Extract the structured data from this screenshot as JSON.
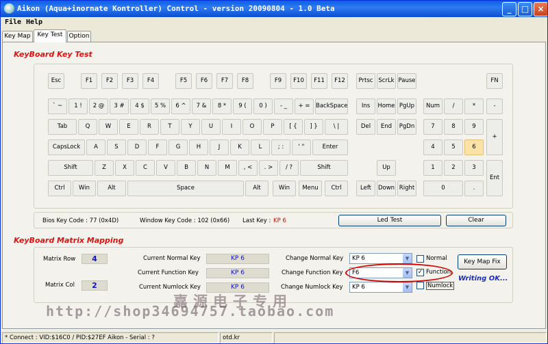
{
  "window": {
    "title": "Aikon (Aqua+inornate Kontroller) Control - version 20090804 - 1.0 Beta",
    "buttons": {
      "minimize": "_",
      "maximize": "□",
      "close": "×"
    }
  },
  "menu": [
    {
      "label": "File"
    },
    {
      "label": "Help"
    }
  ],
  "tabs": [
    {
      "label": "Key Map",
      "active": false
    },
    {
      "label": "Key Test",
      "active": true
    },
    {
      "label": "Option",
      "active": false
    }
  ],
  "keyboard_section": {
    "title": "KeyBoard Key Test",
    "keys": {
      "esc": "Esc",
      "f1": "F1",
      "f2": "F2",
      "f3": "F3",
      "f4": "F4",
      "f5": "F5",
      "f6": "F6",
      "f7": "F7",
      "f8": "F8",
      "f9": "F9",
      "f10": "F10",
      "f11": "F11",
      "f12": "F12",
      "prtsc": "Prtsc",
      "scrlk": "ScrLk",
      "pause": "Pause",
      "fn": "FN",
      "tilde": "` ~",
      "k1": "1 !",
      "k2": "2 @",
      "k3": "3 #",
      "k4": "4 $",
      "k5": "5 %",
      "k6": "6 ^",
      "k7": "7 &",
      "k8": "8 *",
      "k9": "9 (",
      "k0": "0 )",
      "minus": "- _",
      "equal": "+ =",
      "backspace": "BackSpace",
      "ins": "Ins",
      "home": "Home",
      "pgup": "PgUp",
      "num": "Num",
      "slash": "/",
      "star": "*",
      "kpminus": "-",
      "tab": "Tab",
      "q": "Q",
      "w": "W",
      "e": "E",
      "r": "R",
      "t": "T",
      "y": "Y",
      "u": "U",
      "i": "I",
      "o": "O",
      "p": "P",
      "lbracket": "[ {",
      "rbracket": "] }",
      "backslash": "\\ |",
      "del": "Del",
      "end": "End",
      "pgdn": "PgDn",
      "kp7": "7",
      "kp8": "8",
      "kp9": "9",
      "kpplus": "+",
      "capslock": "CapsLock",
      "a": "A",
      "s": "S",
      "d": "D",
      "f": "F",
      "g": "G",
      "h": "H",
      "j": "J",
      "k": "K",
      "l": "L",
      "semicolon": ";  :",
      "quote": "' \"",
      "enter": "Enter",
      "kp4": "4",
      "kp5": "5",
      "kp6": "6",
      "lshift": "Shift",
      "z": "Z",
      "x": "X",
      "c": "C",
      "v": "V",
      "b": "B",
      "n": "N",
      "m": "M",
      "comma": ", <",
      "period": ". >",
      "question": "/ ?",
      "rshift": "Shift",
      "up": "Up",
      "kp1": "1",
      "kp2": "2",
      "kp3": "3",
      "kpenter": "Ent",
      "lctrl": "Ctrl",
      "lwin": "Win",
      "lalt": "Alt",
      "space": "Space",
      "ralt": "Alt",
      "rwin": "Win",
      "menu": "Menu",
      "rctrl": "Ctrl",
      "left": "Left",
      "down": "Down",
      "right": "Right",
      "kp0": "0",
      "kpdot": "."
    },
    "bios_label": "Bios Key Code : 77 (0x4D)",
    "window_label": "Window Key Code : 102 (0x66)",
    "last_label": "Last Key :",
    "last_value": "KP 6",
    "led_test": "Led Test",
    "clear": "Clear"
  },
  "matrix_section": {
    "title": "KeyBoard Matrix Mapping",
    "matrix_row_label": "Matrix Row",
    "matrix_row_value": "4",
    "matrix_col_label": "Matrix Col",
    "matrix_col_value": "2",
    "current_normal_label": "Current Normal Key",
    "current_normal_value": "KP 6",
    "current_function_label": "Current Function Key",
    "current_function_value": "KP 6",
    "current_numlock_label": "Current Numlock Key",
    "current_numlock_value": "KP 6",
    "change_normal_label": "Change Normal Key",
    "change_normal_value": "KP 6",
    "change_function_label": "Change Function Key",
    "change_function_value": "F6",
    "change_numlock_label": "Change Numlock Key",
    "change_numlock_value": "KP 6",
    "opt_normal": "Normal",
    "opt_function": "Function",
    "opt_numlock": "Numlock",
    "check_normal": "",
    "check_function": "✓",
    "check_numlock": "",
    "key_map_fix": "Key Map Fix",
    "writing": "Writing OK..."
  },
  "watermark": {
    "chinese": "嘉源电子专用",
    "url": "http://shop34694757.taobao.com"
  },
  "status": {
    "connect": "* Connect : VID:$16C0 / PID:$27EF Aikon - Serial : ?",
    "site": "otd.kr"
  },
  "colors": {
    "title_bar": "#0a5fe8",
    "section_title": "#e01010",
    "highlight_key": "#fbe3a8",
    "value_blue": "#1010d0",
    "last_key_red": "#dd0000"
  }
}
